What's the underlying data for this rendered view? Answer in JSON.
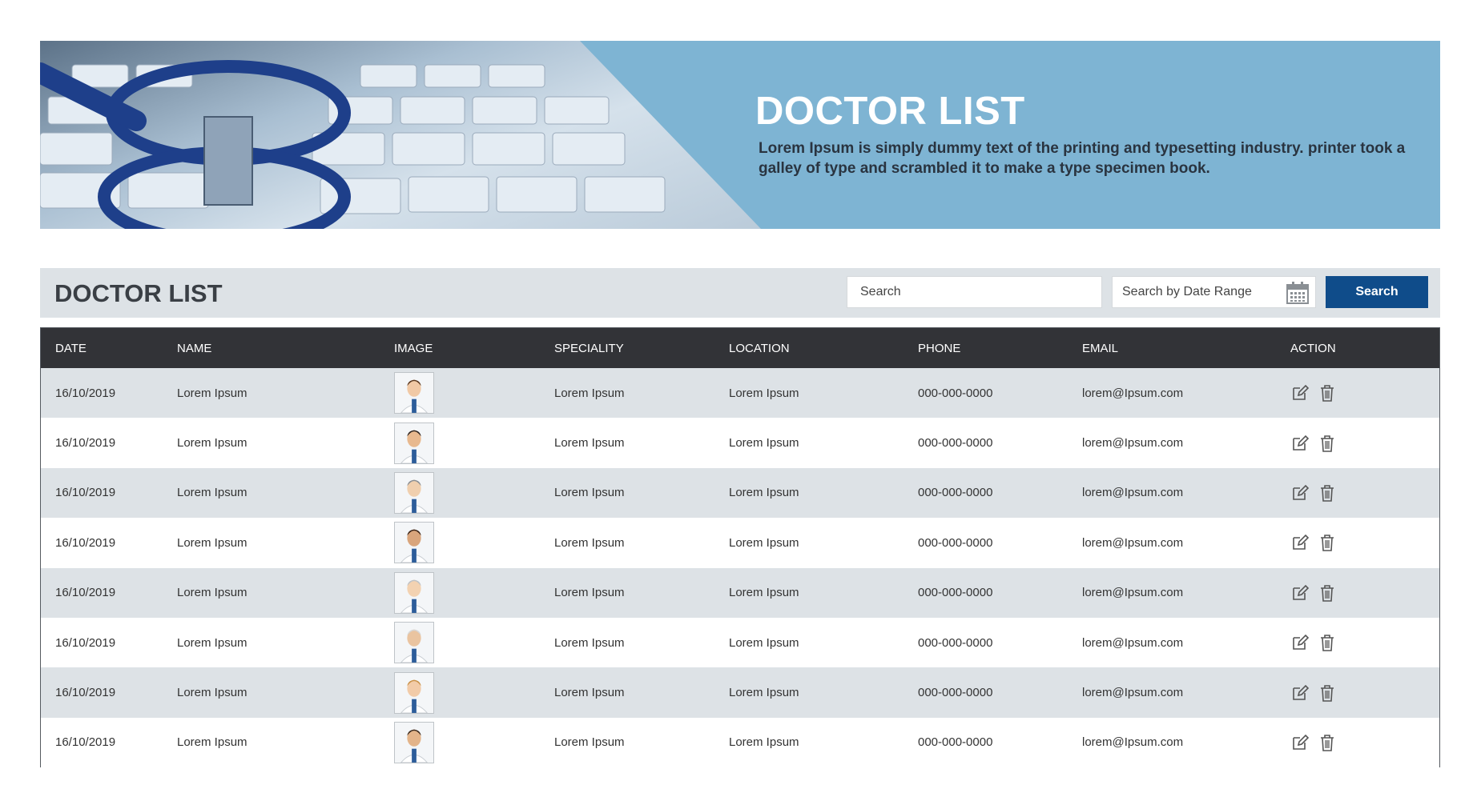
{
  "banner": {
    "title": "DOCTOR LIST",
    "description": "Lorem Ipsum is simply dummy text of the printing and typesetting industry. printer took a galley of type and scrambled it to make a type specimen book."
  },
  "toolbar": {
    "title": "DOCTOR LIST",
    "search_placeholder": "Search",
    "date_placeholder": "Search by Date Range",
    "search_button": "Search",
    "calendar_icon": "calendar-icon"
  },
  "table": {
    "columns": [
      "DATE",
      "NAME",
      "IMAGE",
      "SPECIALITY",
      "LOCATION",
      "PHONE",
      "EMAIL",
      "ACTION"
    ],
    "rows": [
      {
        "date": "16/10/2019",
        "name": "Lorem Ipsum",
        "speciality": "Lorem Ipsum",
        "location": "Lorem Ipsum",
        "phone": "000-000-0000",
        "email": "lorem@Ipsum.com"
      },
      {
        "date": "16/10/2019",
        "name": "Lorem Ipsum",
        "speciality": "Lorem Ipsum",
        "location": "Lorem Ipsum",
        "phone": "000-000-0000",
        "email": "lorem@Ipsum.com"
      },
      {
        "date": "16/10/2019",
        "name": "Lorem Ipsum",
        "speciality": "Lorem Ipsum",
        "location": "Lorem Ipsum",
        "phone": "000-000-0000",
        "email": "lorem@Ipsum.com"
      },
      {
        "date": "16/10/2019",
        "name": "Lorem Ipsum",
        "speciality": "Lorem Ipsum",
        "location": "Lorem Ipsum",
        "phone": "000-000-0000",
        "email": "lorem@Ipsum.com"
      },
      {
        "date": "16/10/2019",
        "name": "Lorem Ipsum",
        "speciality": "Lorem Ipsum",
        "location": "Lorem Ipsum",
        "phone": "000-000-0000",
        "email": "lorem@Ipsum.com"
      },
      {
        "date": "16/10/2019",
        "name": "Lorem Ipsum",
        "speciality": "Lorem Ipsum",
        "location": "Lorem Ipsum",
        "phone": "000-000-0000",
        "email": "lorem@Ipsum.com"
      },
      {
        "date": "16/10/2019",
        "name": "Lorem Ipsum",
        "speciality": "Lorem Ipsum",
        "location": "Lorem Ipsum",
        "phone": "000-000-0000",
        "email": "lorem@Ipsum.com"
      },
      {
        "date": "16/10/2019",
        "name": "Lorem Ipsum",
        "speciality": "Lorem Ipsum",
        "location": "Lorem Ipsum",
        "phone": "000-000-0000",
        "email": "lorem@Ipsum.com"
      }
    ],
    "action_icons": [
      "edit-icon",
      "trash-icon"
    ]
  },
  "colors": {
    "banner": "#7eb4d3",
    "header": "#323337",
    "row_alt": "#dde2e6",
    "button": "#0f4c8a"
  }
}
